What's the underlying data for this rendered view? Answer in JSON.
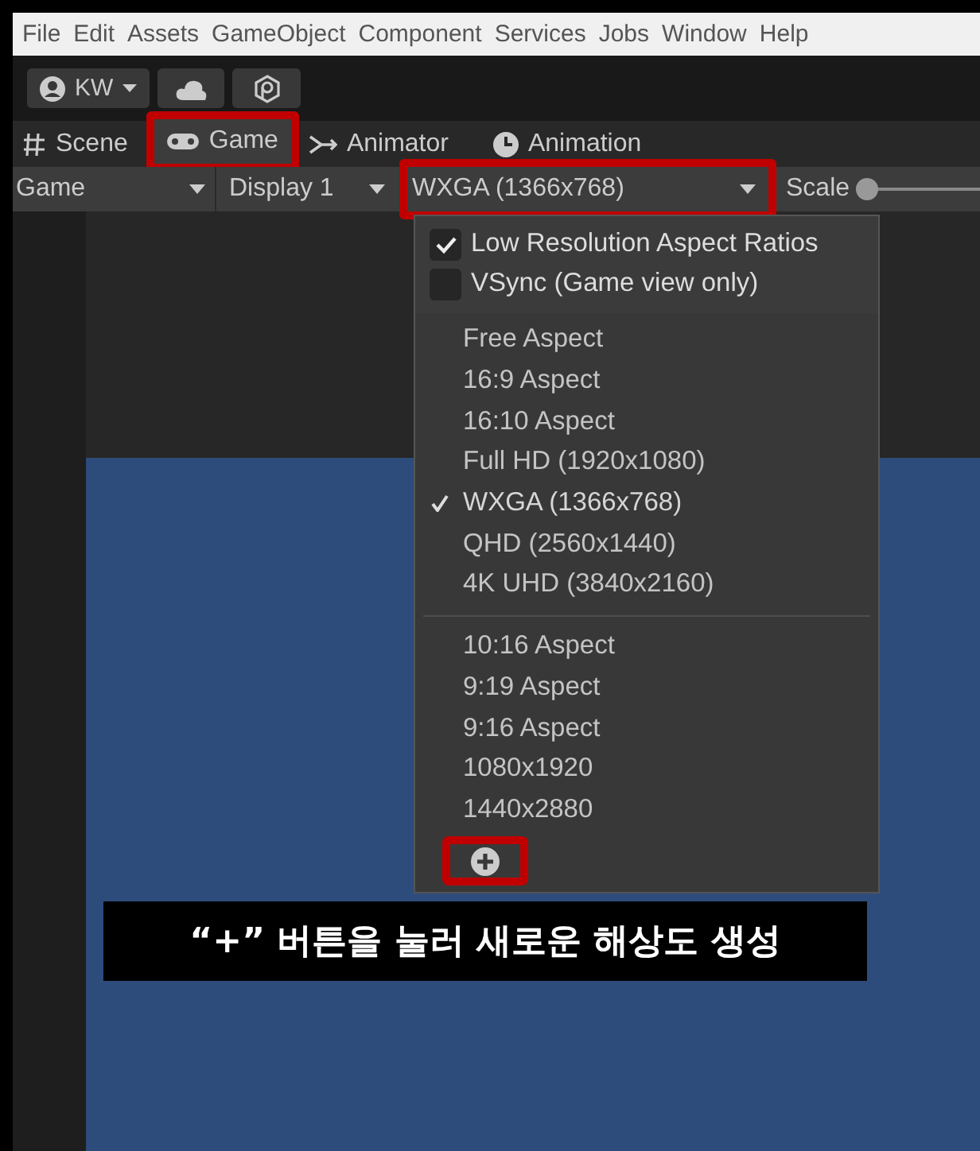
{
  "menu_bar": [
    "File",
    "Edit",
    "Assets",
    "GameObject",
    "Component",
    "Services",
    "Jobs",
    "Window",
    "Help"
  ],
  "account": {
    "label": "KW"
  },
  "tabs": [
    {
      "label": "Scene",
      "selected": false,
      "highlighted": false
    },
    {
      "label": "Game",
      "selected": true,
      "highlighted": true
    },
    {
      "label": "Animator",
      "selected": false,
      "highlighted": false
    },
    {
      "label": "Animation",
      "selected": false,
      "highlighted": false
    }
  ],
  "game_toolbar": {
    "view_dropdown": "Game",
    "display_dropdown": "Display 1",
    "resolution_dropdown": {
      "value": "WXGA (1366x768)",
      "highlighted": true
    },
    "scale_label": "Scale",
    "scale_slider": {
      "level": 0
    }
  },
  "resolution_menu": {
    "toggles": [
      {
        "label": "Low Resolution Aspect Ratios",
        "checked": true
      },
      {
        "label": "VSync (Game view only)",
        "checked": false
      }
    ],
    "groups": [
      {
        "items": [
          {
            "label": "Free Aspect",
            "selected": false
          },
          {
            "label": "16:9 Aspect",
            "selected": false
          },
          {
            "label": "16:10 Aspect",
            "selected": false
          },
          {
            "label": "Full HD (1920x1080)",
            "selected": false
          },
          {
            "label": "WXGA (1366x768)",
            "selected": true
          },
          {
            "label": "QHD (2560x1440)",
            "selected": false
          },
          {
            "label": "4K UHD (3840x2160)",
            "selected": false
          }
        ]
      },
      {
        "items": [
          {
            "label": "10:16 Aspect",
            "selected": false
          },
          {
            "label": "9:19 Aspect",
            "selected": false
          },
          {
            "label": "9:16 Aspect",
            "selected": false
          },
          {
            "label": "1080x1920",
            "selected": false
          },
          {
            "label": "1440x2880",
            "selected": false
          }
        ]
      }
    ],
    "add_button": {
      "highlighted": true
    }
  },
  "caption": "“+” 버튼을 눌러 새로운 해상도 생성"
}
